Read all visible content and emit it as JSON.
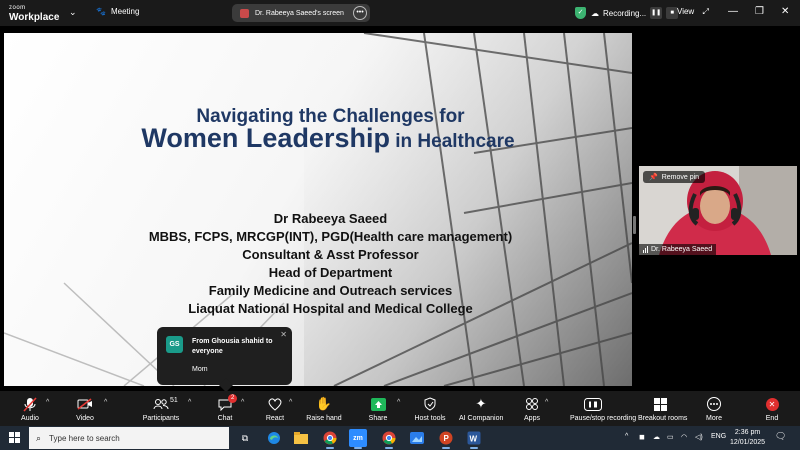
{
  "titlebar": {
    "brand_small": "zoom",
    "brand_big": "Workplace",
    "meeting_label": "Meeting",
    "share_label": "Dr. Rabeeya Saeed's screen",
    "recording_label": "Recording...",
    "view_label": "View",
    "minimize": "—",
    "restore": "❐",
    "close": "✕"
  },
  "slide": {
    "title_line1": "Navigating the Challenges for",
    "title_big": "Women Leadership",
    "title_small": " in Healthcare",
    "lines": [
      "Dr Rabeeya Saeed",
      "MBBS, FCPS, MRCGP(INT), PGD(Health care management)",
      "Consultant & Asst Professor",
      "Head of Department",
      "Family Medicine and Outreach services",
      "Liaquat National Hospital and Medical College"
    ]
  },
  "chat_popup": {
    "avatar": "GS",
    "from": "From Ghousia shahid to everyone",
    "message": "Mom"
  },
  "video": {
    "pin_label": "Remove pin",
    "name": "Dr. Rabeeya Saeed"
  },
  "toolbar": {
    "audio": "Audio",
    "video": "Video",
    "participants": "Participants",
    "participants_count": "51",
    "chat": "Chat",
    "chat_badge": "2",
    "react": "React",
    "raise_hand": "Raise hand",
    "share": "Share",
    "host_tools": "Host tools",
    "ai_companion": "AI Companion",
    "apps": "Apps",
    "pause_recording": "Pause/stop recording",
    "breakout_rooms": "Breakout rooms",
    "more": "More",
    "end": "End"
  },
  "taskbar": {
    "search_placeholder": "Type here to search",
    "zoom_app": "zm",
    "language": "ENG",
    "time": "2:36 pm",
    "date": "12/01/2025"
  },
  "colors": {
    "title_blue": "#1f3864",
    "toolbar_bg": "#1a1a1a",
    "end_red": "#e02f2f",
    "share_green": "#1fb85a",
    "taskbar_bg": "#202a36"
  }
}
